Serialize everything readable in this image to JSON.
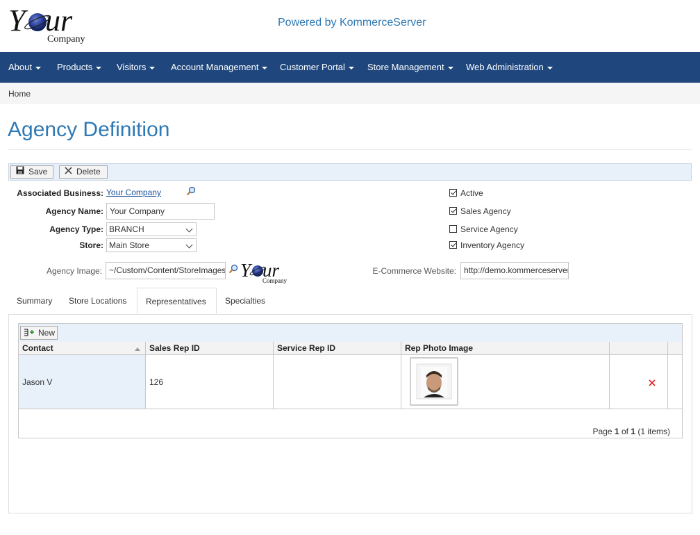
{
  "header": {
    "logo_text_main": "Your",
    "logo_text_sub": "Company",
    "powered_by": "Powered by KommerceServer"
  },
  "nav": {
    "items": [
      {
        "label": "About"
      },
      {
        "label": "Products"
      },
      {
        "label": "Visitors"
      },
      {
        "label": "Account Management"
      },
      {
        "label": "Customer Portal"
      },
      {
        "label": "Store Management"
      },
      {
        "label": "Web Administration"
      }
    ]
  },
  "breadcrumb": {
    "home": "Home"
  },
  "page": {
    "title": "Agency Definition"
  },
  "toolbar": {
    "save_label": "Save",
    "delete_label": "Delete"
  },
  "form": {
    "associated_business_label": "Associated Business:",
    "associated_business_value": "Your Company",
    "agency_name_label": "Agency Name:",
    "agency_name_value": "Your Company",
    "agency_type_label": "Agency Type:",
    "agency_type_value": "BRANCH",
    "store_label": "Store:",
    "store_value": "Main Store",
    "agency_image_label": "Agency Image:",
    "agency_image_value": "~/Custom/Content/StoreImages/",
    "ecommerce_label": "E-Commerce Website:",
    "ecommerce_value": "http://demo.kommerceserver",
    "checkboxes": [
      {
        "label": "Active",
        "checked": true
      },
      {
        "label": "Sales Agency",
        "checked": true
      },
      {
        "label": "Service Agency",
        "checked": false
      },
      {
        "label": "Inventory Agency",
        "checked": true
      }
    ]
  },
  "tabs": [
    {
      "label": "Summary",
      "active": false
    },
    {
      "label": "Store Locations",
      "active": false
    },
    {
      "label": "Representatives",
      "active": true
    },
    {
      "label": "Specialties",
      "active": false
    }
  ],
  "grid": {
    "new_label": "New",
    "columns": [
      "Contact",
      "Sales Rep ID",
      "Service Rep ID",
      "Rep Photo Image"
    ],
    "rows": [
      {
        "contact": "Jason V",
        "sales_rep_id": "126",
        "service_rep_id": ""
      }
    ],
    "pager": {
      "prefix": "Page",
      "page": "1",
      "of": "of",
      "total": "1",
      "items": "(1 items)"
    }
  },
  "colors": {
    "nav_bg": "#1f477e",
    "accent": "#2e79b4",
    "delete_red": "#e02020"
  }
}
